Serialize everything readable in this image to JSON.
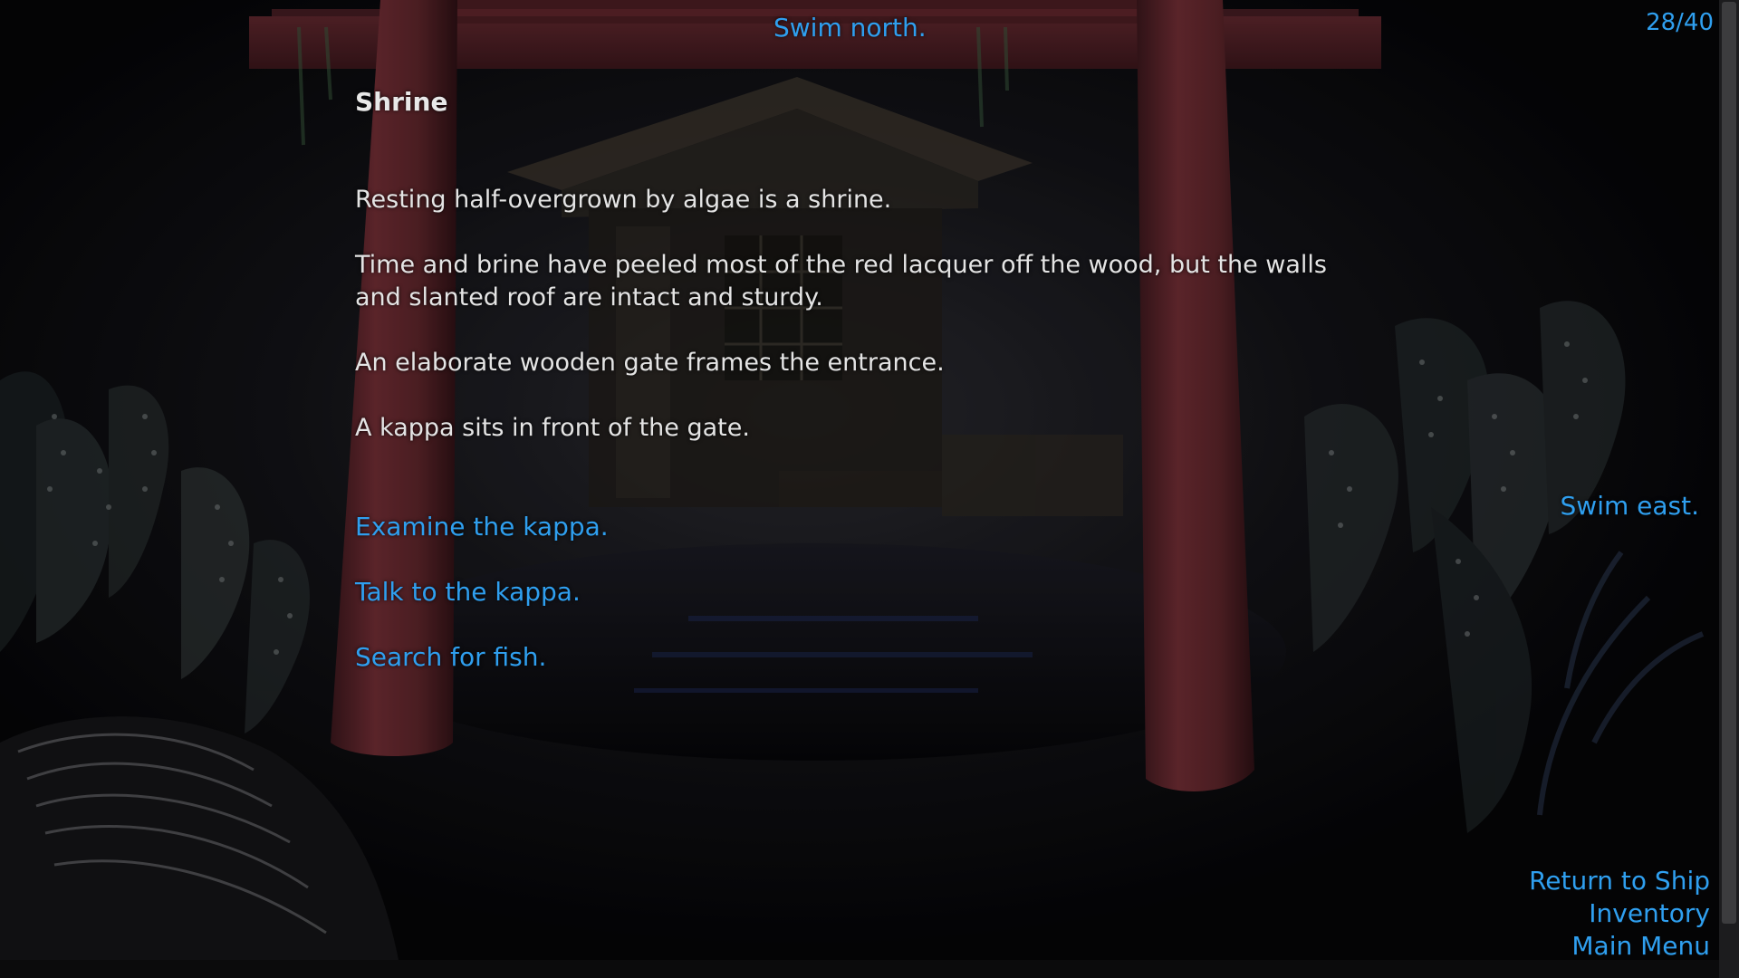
{
  "game": {
    "counter": "28/40",
    "nav": {
      "north": "Swim north.",
      "east": "Swim east."
    },
    "location": {
      "title": "Shrine",
      "paragraphs": [
        "Resting half-overgrown by algae is a shrine.",
        "Time and brine have peeled most of the red lacquer off the wood, but the walls and slanted roof are intact and sturdy.",
        "An elaborate wooden gate frames the entrance.",
        "A kappa sits in front of the gate."
      ]
    },
    "choices": [
      "Examine the kappa.",
      "Talk to the kappa.",
      "Search for fish."
    ],
    "menu": {
      "return": "Return to Ship",
      "inventory": "Inventory",
      "main": "Main Menu"
    }
  },
  "colors": {
    "link": "#2f9fef",
    "text": "#e4e4e4",
    "background": "#060608",
    "torii_red": "#6b2a30"
  }
}
